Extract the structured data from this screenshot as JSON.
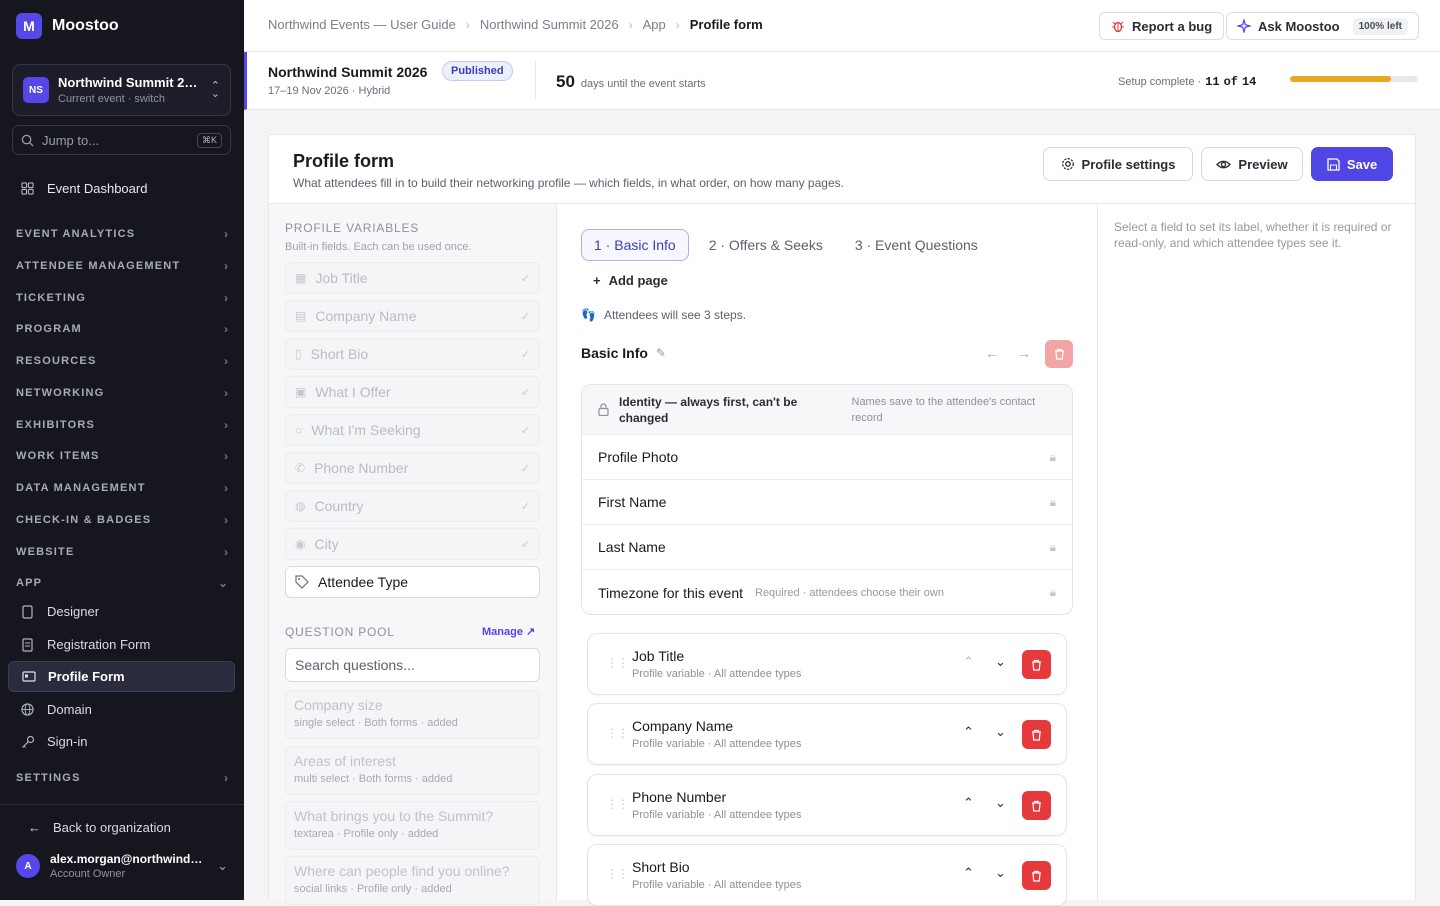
{
  "app": {
    "logo_letter": "M",
    "name": "Moostoo"
  },
  "event_switcher": {
    "initials": "NS",
    "title": "Northwind Summit 2…",
    "subtitle": "Current event · switch"
  },
  "jump": {
    "placeholder": "Jump to...",
    "shortcut": "⌘K"
  },
  "nav": {
    "dashboard": "Event Dashboard",
    "sections": [
      "EVENT ANALYTICS",
      "ATTENDEE MANAGEMENT",
      "TICKETING",
      "PROGRAM",
      "RESOURCES",
      "NETWORKING",
      "EXHIBITORS",
      "WORK ITEMS",
      "DATA MANAGEMENT",
      "CHECK-IN & BADGES",
      "WEBSITE"
    ],
    "app_section": "APP",
    "app_items": [
      "Designer",
      "Registration Form",
      "Profile Form",
      "Domain",
      "Sign-in"
    ],
    "settings": "SETTINGS",
    "back": "Back to organization"
  },
  "user": {
    "initial": "A",
    "name": "alex.morgan@northwind…",
    "role": "Account Owner"
  },
  "breadcrumb": [
    "Northwind Events — User Guide",
    "Northwind Summit 2026",
    "App",
    "Profile form"
  ],
  "topbar": {
    "report_bug": "Report a bug",
    "ask": "Ask Moostoo",
    "ask_quota": "100% left"
  },
  "event_bar": {
    "title": "Northwind Summit 2026",
    "status": "Published",
    "dates": "17–19 Nov 2026 · Hybrid",
    "days_count": "50",
    "days_label": "days until the event starts",
    "setup_label": "Setup complete ·",
    "setup_done": "11",
    "setup_of": "of",
    "setup_total": "14",
    "setup_progress": 0.786
  },
  "page": {
    "title": "Profile form",
    "subtitle": "What attendees fill in to build their networking profile — which fields, in what order, on how many pages.",
    "settings_btn": "Profile settings",
    "preview_btn": "Preview",
    "save_btn": "Save"
  },
  "profile_variables": {
    "heading": "PROFILE VARIABLES",
    "subheading": "Built-in fields. Each can be used once.",
    "items": [
      {
        "label": "Job Title",
        "icon": "building-icon",
        "used": true
      },
      {
        "label": "Company Name",
        "icon": "office-icon",
        "used": true
      },
      {
        "label": "Short Bio",
        "icon": "document-icon",
        "used": true
      },
      {
        "label": "What I Offer",
        "icon": "gift-icon",
        "used": true
      },
      {
        "label": "What I'm Seeking",
        "icon": "search-icon",
        "used": true
      },
      {
        "label": "Phone Number",
        "icon": "phone-icon",
        "used": true
      },
      {
        "label": "Country",
        "icon": "globe-icon",
        "used": true
      },
      {
        "label": "City",
        "icon": "pin-icon",
        "used": true
      },
      {
        "label": "Attendee Type",
        "icon": "tag-icon",
        "used": false
      }
    ]
  },
  "question_pool": {
    "heading": "QUESTION POOL",
    "manage": "Manage",
    "search_placeholder": "Search questions...",
    "items": [
      {
        "title": "Company size",
        "meta": "single select · Both forms · added"
      },
      {
        "title": "Areas of interest",
        "meta": "multi select · Both forms · added"
      },
      {
        "title": "What brings you to the Summit?",
        "meta": "textarea · Profile only · added"
      },
      {
        "title": "Where can people find you online?",
        "meta": "social links · Profile only · added"
      }
    ]
  },
  "tabs": [
    "1 · Basic Info",
    "2 · Offers & Seeks",
    "3 · Event Questions"
  ],
  "add_page": "Add page",
  "steps_note": "Attendees will see 3 steps.",
  "page_name": "Basic Info",
  "identity": {
    "heading": "Identity — always first, can't be changed",
    "note": "Names save to the attendee's contact record",
    "rows": [
      {
        "label": "Profile Photo",
        "note": ""
      },
      {
        "label": "First Name",
        "note": ""
      },
      {
        "label": "Last Name",
        "note": ""
      },
      {
        "label": "Timezone for this event",
        "note": "Required · attendees choose their own"
      }
    ]
  },
  "fields": [
    {
      "title": "Job Title",
      "meta": "Profile variable · All attendee types"
    },
    {
      "title": "Company Name",
      "meta": "Profile variable · All attendee types"
    },
    {
      "title": "Phone Number",
      "meta": "Profile variable · All attendee types"
    },
    {
      "title": "Short Bio",
      "meta": "Profile variable · All attendee types"
    }
  ],
  "inspector_hint": "Select a field to set its label, whether it is required or read-only, and which attendee types see it.",
  "colors": {
    "accent": "#4f46e5",
    "danger": "#e5393c",
    "progress": "#e9a81f",
    "sidebar": "#15161e"
  }
}
